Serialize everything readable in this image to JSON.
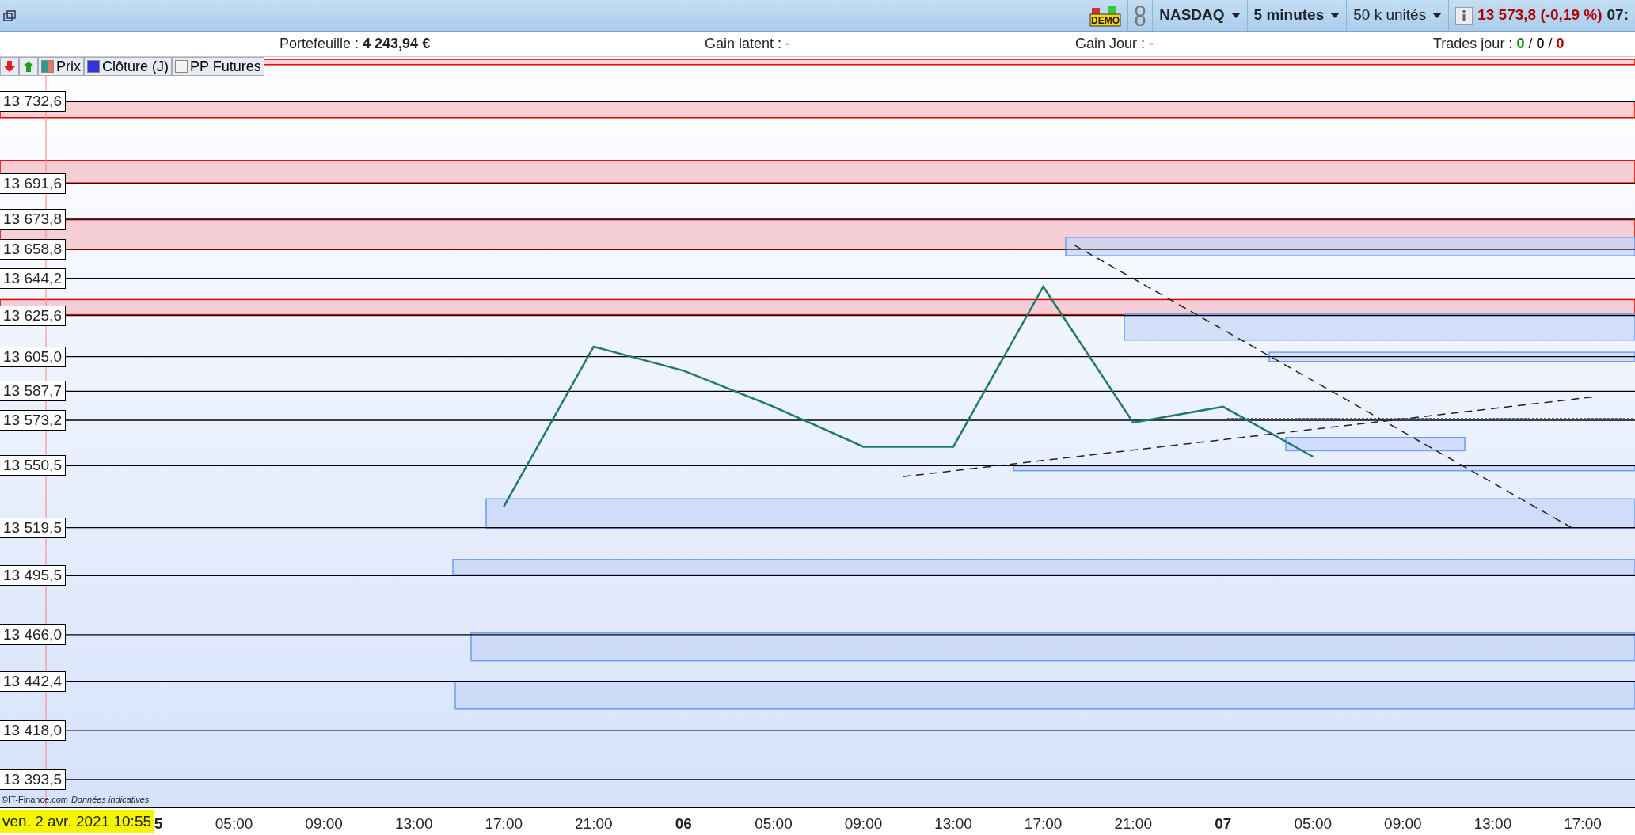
{
  "toolbar": {
    "demo_label": "DEMO",
    "market": "NASDAQ",
    "interval": "5 minutes",
    "quantity": "50 k unités",
    "price": "13 573,8 (-0,19 %)",
    "time": "07:"
  },
  "info_bar": {
    "portfolio_label": "Portefeuille : ",
    "portfolio_value": "4 243,94 €",
    "latent": "Gain latent : -",
    "day": "Gain Jour : -",
    "trades_label": "Trades jour : ",
    "trades": [
      {
        "value": "0",
        "color": "#0a8a0a"
      },
      {
        "value": "0",
        "color": "#000000"
      },
      {
        "value": "0",
        "color": "#b00000"
      }
    ],
    "separator": "/"
  },
  "legend": [
    {
      "label": "Clôture (J)",
      "kind": "solid"
    },
    {
      "label": "PP Futures",
      "kind": "empty"
    }
  ],
  "chart": {
    "chart_data": {
      "type": "line",
      "x": [
        "5",
        "05:00",
        "09:00",
        "13:00",
        "17:00",
        "21:00",
        "06",
        "05:00",
        "09:00",
        "13:00",
        "17:00",
        "21:00",
        "07",
        "05:00",
        "09:00",
        "13:00",
        "17:00"
      ],
      "grid": true,
      "series": [
        {
          "name": "Prix",
          "color": "#1f7a6e",
          "values": [
            null,
            null,
            null,
            null,
            13530,
            13610,
            13598,
            13580,
            13560,
            13560,
            13640,
            13572,
            13580,
            13555,
            null,
            null,
            null
          ]
        }
      ],
      "ylim": [
        13393.5,
        13753.7
      ],
      "yticks": [
        {
          "value": 13732.6,
          "label": "13 732,6"
        },
        {
          "value": 13691.6,
          "label": "13 691,6"
        },
        {
          "value": 13673.8,
          "label": "13 673,8"
        },
        {
          "value": 13658.8,
          "label": "13 658,8"
        },
        {
          "value": 13644.2,
          "label": "13 644,2"
        },
        {
          "value": 13625.6,
          "label": "13 625,6"
        },
        {
          "value": 13605.0,
          "label": "13 605,0"
        },
        {
          "value": 13587.7,
          "label": "13 587,7"
        },
        {
          "value": 13573.2,
          "label": "13 573,2"
        },
        {
          "value": 13550.5,
          "label": "13 550,5"
        },
        {
          "value": 13519.5,
          "label": "13 519,5"
        },
        {
          "value": 13495.5,
          "label": "13 495,5"
        },
        {
          "value": 13466.0,
          "label": "13 466,0"
        },
        {
          "value": 13442.4,
          "label": "13 442,4"
        },
        {
          "value": 13418.0,
          "label": "13 418,0"
        },
        {
          "value": 13393.5,
          "label": "13 393,5"
        }
      ]
    },
    "day_start": [
      true,
      false,
      false,
      false,
      false,
      false,
      true,
      false,
      false,
      false,
      false,
      false,
      true,
      false,
      false,
      false,
      false
    ],
    "copyright": "©IT-Finance.com",
    "disclaimer": "Données indicatives",
    "date": "ven. 2 avr. 2021 10:55"
  }
}
